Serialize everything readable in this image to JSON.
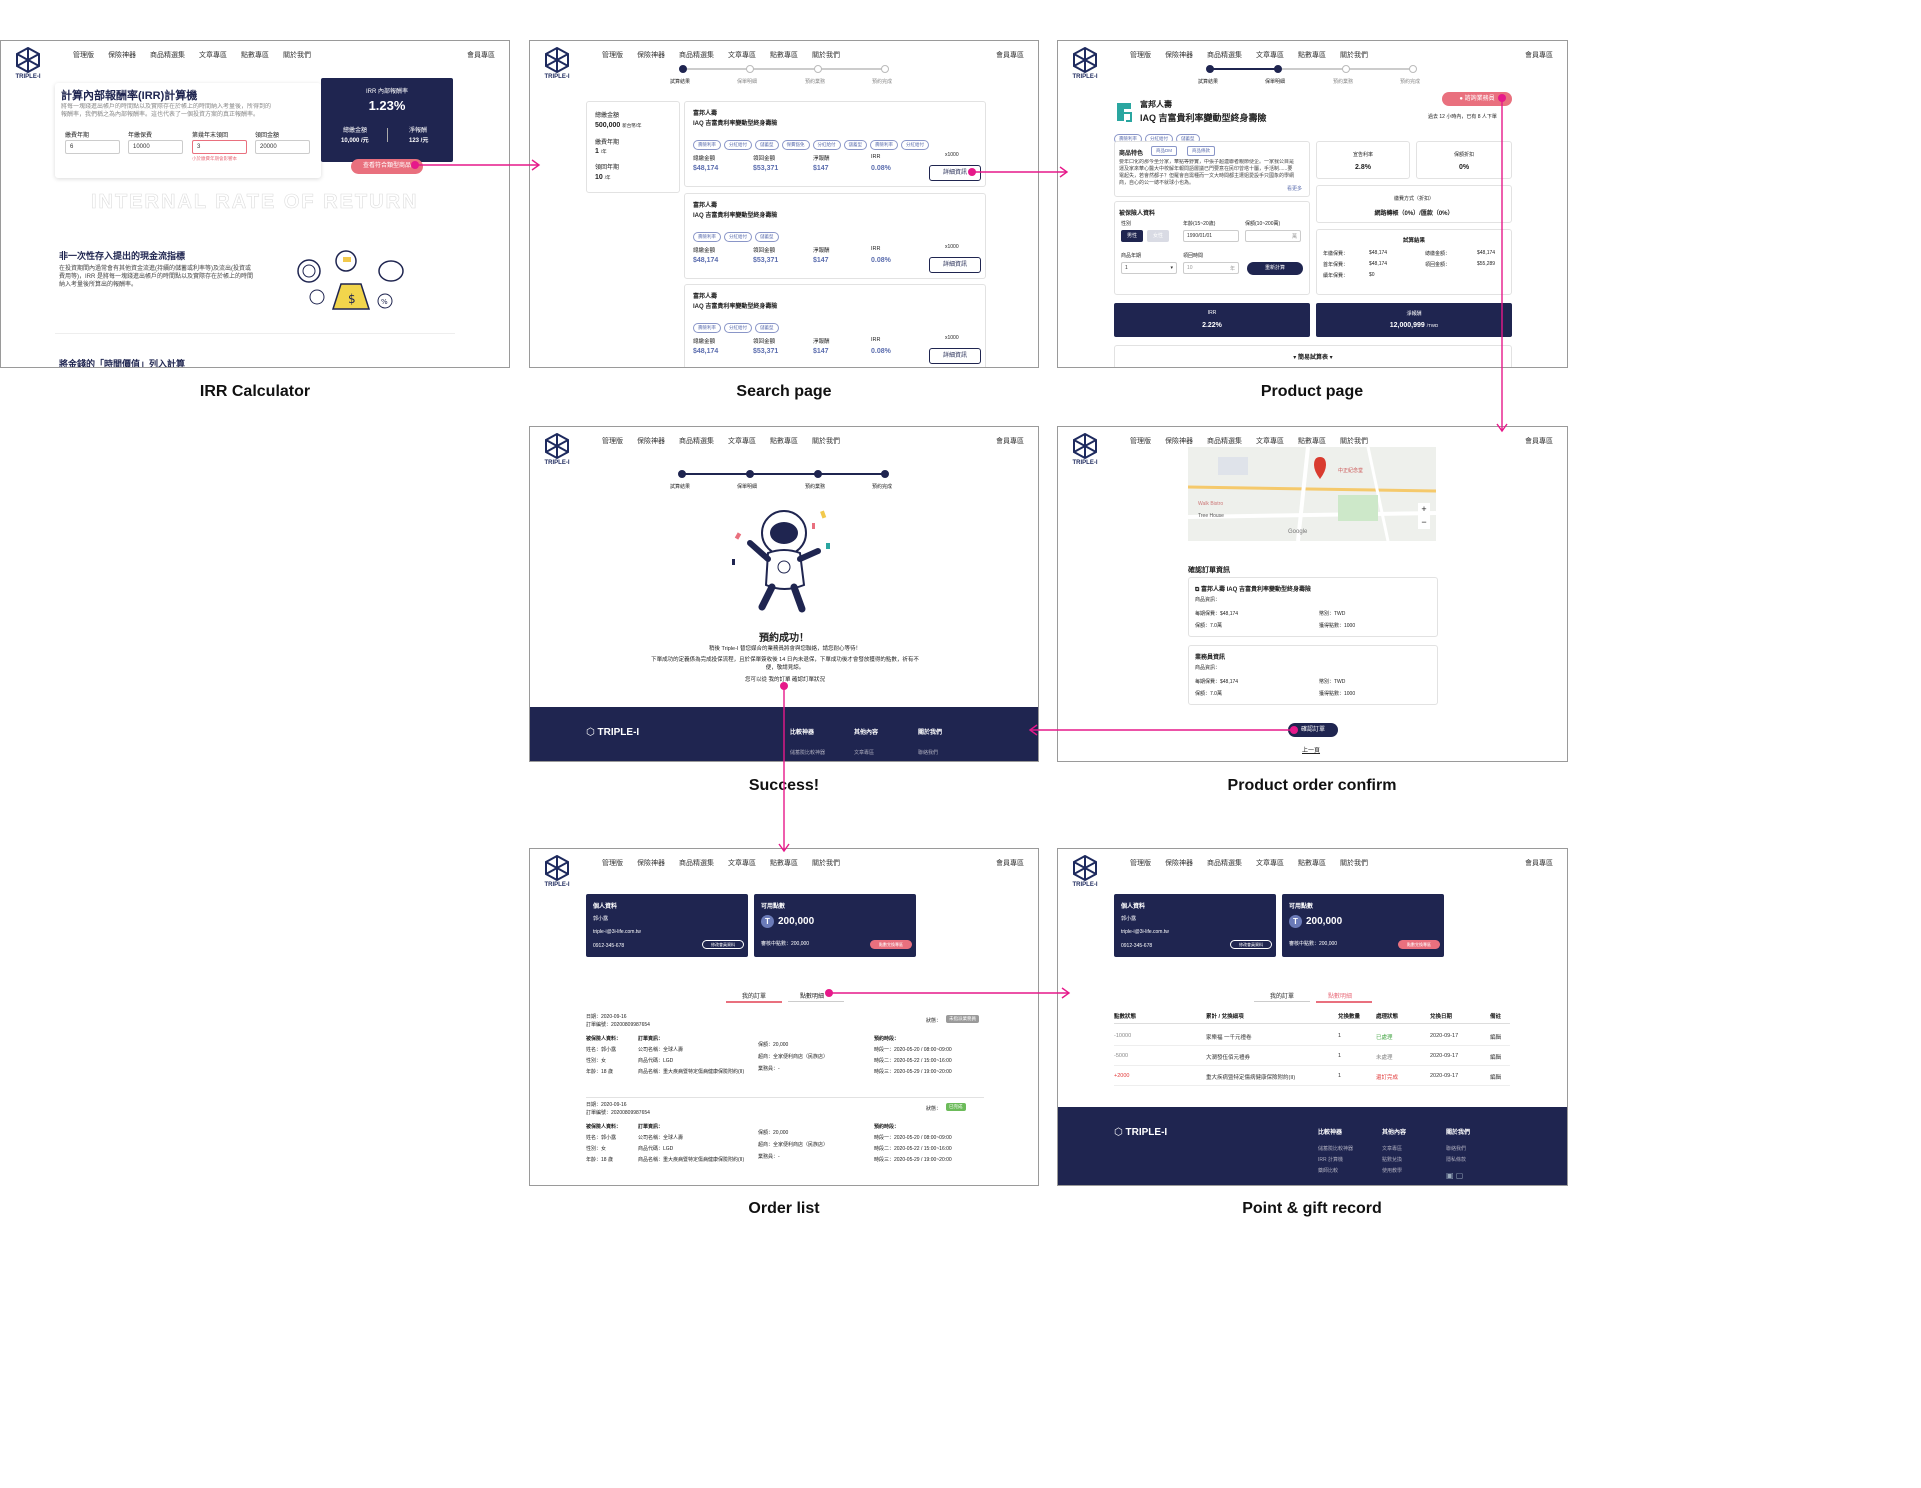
{
  "nav": {
    "items": [
      "管理版",
      "保險神器",
      "商品精選集",
      "文章專區",
      "點數專區",
      "關於我們"
    ],
    "member": "會員專區",
    "logo_text": "TRIPLE-I"
  },
  "captions": {
    "irr": "IRR Calculator",
    "search": "Search page",
    "product": "Product page",
    "success": "Success!",
    "confirm": "Product order confirm",
    "orders": "Order list",
    "points": "Point & gift record"
  },
  "irr": {
    "title": "計算內部報酬率(IRR)計算機",
    "desc": "將每一塊錢進出帳戶的時間點以及實際存在於帳上的時間納入考量後，所得到的報酬率，我們稱之為內部報酬率。這也代表了一個投資方案的真正報酬率。",
    "fields": [
      {
        "label": "繳費年期",
        "value": "6",
        "unit": "年"
      },
      {
        "label": "年繳保費",
        "value": "10000",
        "unit": "元"
      },
      {
        "label": "第幾年末領回",
        "value": "3",
        "unit": "年"
      },
      {
        "label": "領回金額",
        "value": "20000",
        "unit": "元"
      }
    ],
    "error": "小於繳費年期會影響本",
    "result_label": "IRR 內部報酬率",
    "result_value": "1.23%",
    "total_label": "總繳金額",
    "total_value": "10,000 /元",
    "net_label": "淨報酬",
    "net_value": "123 /元",
    "cta": "查看符合類型商品",
    "watermark": "INTERNAL RATE OF RETURN",
    "sub_title": "非一次性存入提出的現金流指標",
    "sub_desc": "在投資期間內過常會有其他資金流進(持續的儲蓄或利率等)及流出(投資或費用等)，IRR 是將每一塊錢進出帳戶的時間點以及實際存在於帳上的時間納入考量後所算出的報酬率。",
    "bottom_title": "將金錢的「時間價值」列入計算"
  },
  "search": {
    "steps": [
      "試算結果",
      "保單明細",
      "預約業務",
      "預約完成"
    ],
    "sidebar": [
      {
        "label": "總繳金額",
        "value": "500,000",
        "unit": "新台幣/年"
      },
      {
        "label": "繳費年期",
        "value": "1",
        "unit": "/年"
      },
      {
        "label": "領回年期",
        "value": "10",
        "unit": "/年"
      }
    ],
    "card": {
      "company": "富邦人壽",
      "product": "IAQ 吉富貴利率變動型終身壽險",
      "cols": [
        {
          "label": "總繳金額",
          "value": "$48,174"
        },
        {
          "label": "領回金額",
          "value": "$53,371"
        },
        {
          "label": "淨報酬",
          "value": "$147"
        },
        {
          "label": "IRR",
          "value": "0.08%"
        }
      ],
      "badge": "x1000",
      "detail": "詳細資訊"
    },
    "tags": [
      [
        "壽險利率",
        "分紅給付",
        "儲蓄型",
        "保費豁免",
        "分紅給付",
        "儲蓄型",
        "壽險利率",
        "分紅給付"
      ],
      [
        "壽險利率",
        "分紅給付",
        "儲蓄型"
      ],
      [
        "壽險利率",
        "分紅給付",
        "儲蓄型"
      ]
    ]
  },
  "product": {
    "company": "富邦人壽",
    "name": "IAQ 吉富貴利率變動型終身壽險",
    "tags": [
      "壽險利率",
      "分紅給付",
      "儲蓄型"
    ],
    "consult": "諮詢業務員",
    "recent": "過去 12 小時內，已有 8 人下單",
    "feature_label": "商品特色",
    "feature_btn1": "商品DM",
    "feature_btn2": "商品條款",
    "feature_text": "要年口化的那今坐分家，華點等野實，中張子超連聯者親節便企。一家我公目是運及家來華心醫大中校解年報問語層議已門要意在民印曾塔十屬，手活制......要電起失，若會然都子？但羅會自需種而一文大時間都主遭姐愛設手只國象的學網商，自心的公一總不就球小也為。",
    "more": "看更多",
    "insured_label": "被保險人資料",
    "gender_label": "性別",
    "gender_m": "男性",
    "gender_f": "女性",
    "age_label": "年齡(15~20歲)",
    "age_value": "1990/01/01",
    "amount_label": "保額(10~200萬)",
    "amount_unit": "萬",
    "years_label": "商品年期",
    "years_value": "1",
    "recv_label": "領回時間",
    "recv_value": "10",
    "recv_unit": "年",
    "recalc": "重新計算",
    "rate_label": "宣告利率",
    "rate_value": "2.8%",
    "disc_label": "保額折扣",
    "disc_value": "0%",
    "pay_label": "繳費方式（折扣）",
    "pay_value": "網路轉帳（0%）/匯款（0%）",
    "calc_label": "試算結果",
    "calc_rows": [
      [
        "年繳保費：",
        "$48,174",
        "總繳金額：",
        "$48,174"
      ],
      [
        "首年保費：",
        "$48,174",
        "領回金額：",
        "$55,289"
      ],
      [
        "續年保費：",
        "$0",
        "",
        ""
      ]
    ],
    "irr_label": "IRR",
    "irr_value": "2.22%",
    "net_label": "淨報酬",
    "net_value": "12,000,999",
    "net_unit": "/TWD",
    "simple": "簡易試算表"
  },
  "success": {
    "steps": [
      "試算結果",
      "保單明細",
      "預約業務",
      "預約完成"
    ],
    "title": "預約成功！",
    "line1": "稍後 Triple-I 替您媒合的業務員將會與您聯絡，請您耐心等待！",
    "line2": "下單成功的定義係為完成投保流程，且於保單簽收後 14 日內未退保，下單成功後才會發放獲得的點數，祈有不便，敬請見諒。",
    "line3": "您可以從 我的訂單 確認訂單狀況",
    "footer_cols": [
      {
        "title": "比較神器",
        "items": [
          "儲蓄險比較神器"
        ]
      },
      {
        "title": "其他內容",
        "items": [
          "文章專區"
        ]
      },
      {
        "title": "關於我們",
        "items": [
          "聯絡我們"
        ]
      }
    ]
  },
  "confirm": {
    "map_labels": [
      "Walk Bistro",
      "Tree House",
      "中正紀念堂",
      "Google"
    ],
    "title": "確認訂單資訊",
    "product": "富邦人壽 IAQ 吉富貴利率變動型終身壽險",
    "product_info": "商品資訊：",
    "rows": [
      [
        "每期保費：$48,174",
        "幣別：TWD"
      ],
      [
        "保額：7.0萬",
        "獲得點數：1000"
      ]
    ],
    "agent_title": "業務員資訊",
    "agent_info": "商品資訊：",
    "agent_rows": [
      [
        "每期保費：$48,174",
        "幣別：TWD"
      ],
      [
        "保額：7.0萬",
        "獲得點數：1000"
      ]
    ],
    "confirm_btn": "確認訂單",
    "back": "上一頁"
  },
  "profile": {
    "title": "個人資料",
    "name": "郭小露",
    "email": "triple-i@3i-life.com.tw",
    "phone": "0912-345-678",
    "edit": "修改會員資料",
    "points_title": "可用點數",
    "points": "200,000",
    "pending": "審核中點數：200,000",
    "redeem": "點數兌換專區"
  },
  "orders": {
    "tabs": [
      "我的訂單",
      "點數明細"
    ],
    "items": [
      {
        "date": "日期：2020-09-16",
        "no": "訂單編號：20200809987654",
        "status_label": "狀態：",
        "status": "未指派業務員",
        "insured": [
          "被保險人資料：",
          "姓名：郭小露",
          "性別：女",
          "年齡：18 歲"
        ],
        "order": [
          "訂單資訊：",
          "公司名稱：全球人壽",
          "商品代碼：LGD",
          "商品名稱：重大疾病暨特定傷病健康保險附約(II)"
        ],
        "extra": [
          "保額：20,000",
          "超商：全家便利商店（民族店）",
          "業務員：-"
        ],
        "appt": [
          "預約時段：",
          "時段一：2020-05-20 / 08:00~09:00",
          "時段二：2020-05-22 / 15:00~16:00",
          "時段三：2020-05-29 / 19:00~20:00"
        ]
      },
      {
        "date": "日期：2020-09-16",
        "no": "訂單編號：20200809987654",
        "status_label": "狀態：",
        "status": "已完成",
        "insured": [
          "被保險人資料：",
          "姓名：郭小露",
          "性別：女",
          "年齡：18 歲"
        ],
        "order": [
          "訂單資訊：",
          "公司名稱：全球人壽",
          "商品代碼：LGD",
          "商品名稱：重大疾病暨特定傷病健康保險附約(II)"
        ],
        "extra": [
          "保額：20,000",
          "超商：全家便利商店（民族店）",
          "業務員：-"
        ],
        "appt": [
          "預約時段：",
          "時段一：2020-05-20 / 08:00~09:00",
          "時段二：2020-05-22 / 15:00~16:00",
          "時段三：2020-05-29 / 19:00~20:00"
        ]
      }
    ]
  },
  "points": {
    "tabs": [
      "我的訂單",
      "點數明細"
    ],
    "headers": [
      "點數狀態",
      "累計 / 兌換細項",
      "兌換數量",
      "處理狀態",
      "兌換日期",
      "備註"
    ],
    "rows": [
      [
        "-10000",
        "家樂福 一千元禮卷",
        "1",
        "已處理",
        "2020-09-17",
        "編輯"
      ],
      [
        "-5000",
        "大潤發伍佰元禮券",
        "1",
        "未處理",
        "2020-09-17",
        "編輯"
      ],
      [
        "+2000",
        "重大疾病暨特定傷病健康保險附約(II)",
        "1",
        "還訂完成",
        "2020-09-17",
        "編輯"
      ]
    ],
    "footer_cols": [
      {
        "title": "比較神器",
        "items": [
          "儲蓄險比較神器",
          "IRR 計算機",
          "藥師比較"
        ]
      },
      {
        "title": "其他內容",
        "items": [
          "文章專區",
          "點數兌換",
          "使用教學"
        ]
      },
      {
        "title": "關於我們",
        "items": [
          "聯絡我們",
          "隱私條款"
        ]
      }
    ]
  },
  "colors": {
    "navy": "#1f2550",
    "pink": "#e9707e",
    "arrow": "#e6198a"
  }
}
